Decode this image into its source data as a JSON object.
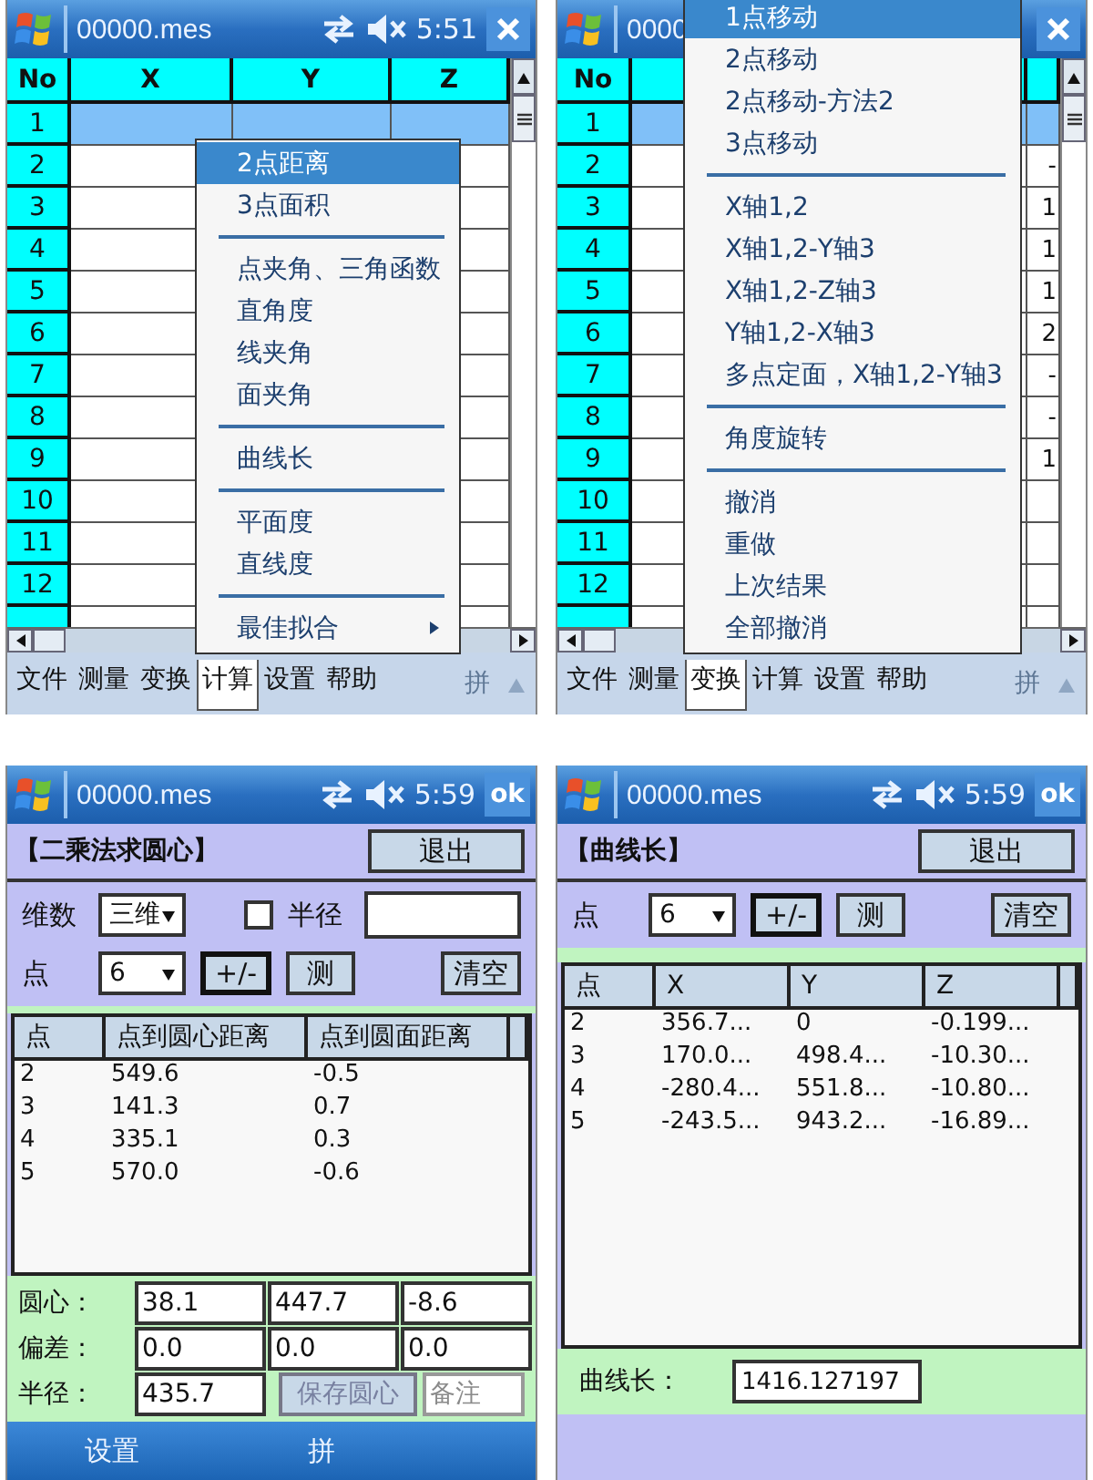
{
  "screens": [
    {
      "kind": "table_menu",
      "title": "00000.mes",
      "time": "5:51",
      "action": {
        "kind": "close"
      },
      "columns": [
        {
          "kind": "number",
          "label": "No"
        },
        {
          "kind": "data",
          "label": "X"
        },
        {
          "kind": "data",
          "label": "Y"
        },
        {
          "kind": "data",
          "label": "Z"
        }
      ],
      "rows": [
        {
          "no": "1",
          "selected": true
        },
        {
          "no": "2",
          "selected": false
        },
        {
          "no": "3",
          "selected": false
        },
        {
          "no": "4",
          "selected": false
        },
        {
          "no": "5",
          "selected": false
        },
        {
          "no": "6",
          "selected": false
        },
        {
          "no": "7",
          "selected": false
        },
        {
          "no": "8",
          "selected": false
        },
        {
          "no": "9",
          "selected": false
        },
        {
          "no": "10",
          "selected": false
        },
        {
          "no": "11",
          "selected": false
        },
        {
          "no": "12",
          "selected": false
        }
      ],
      "menubar": [
        {
          "label": "文件",
          "selected": false
        },
        {
          "label": "测量",
          "selected": false
        },
        {
          "label": "变换",
          "selected": false
        },
        {
          "label": "计算",
          "selected": true
        },
        {
          "label": "设置",
          "selected": false
        },
        {
          "label": "帮助",
          "selected": false
        }
      ],
      "input_mode": "拼",
      "menu": [
        {
          "kind": "item",
          "label": "2点距离",
          "selected": true
        },
        {
          "kind": "item",
          "label": "3点面积",
          "selected": false
        },
        {
          "kind": "separator"
        },
        {
          "kind": "item",
          "label": "点夹角、三角函数",
          "selected": false
        },
        {
          "kind": "item",
          "label": "直角度",
          "selected": false
        },
        {
          "kind": "item",
          "label": "线夹角",
          "selected": false
        },
        {
          "kind": "item",
          "label": "面夹角",
          "selected": false
        },
        {
          "kind": "separator"
        },
        {
          "kind": "item",
          "label": "曲线长",
          "selected": false
        },
        {
          "kind": "separator"
        },
        {
          "kind": "item",
          "label": "平面度",
          "selected": false
        },
        {
          "kind": "item",
          "label": "直线度",
          "selected": false
        },
        {
          "kind": "separator"
        },
        {
          "kind": "submenu",
          "label": "最佳拟合",
          "selected": false
        }
      ]
    },
    {
      "kind": "table_menu",
      "title": "0000",
      "action": {
        "kind": "close"
      },
      "columns": [
        {
          "kind": "number",
          "label": "No"
        },
        {
          "kind": "data"
        },
        {
          "kind": "data"
        }
      ],
      "rows": [
        {
          "no": "1",
          "selected": true
        },
        {
          "no": "2",
          "selected": false,
          "column_3": "-"
        },
        {
          "no": "3",
          "selected": false,
          "column_3": "1"
        },
        {
          "no": "4",
          "selected": false,
          "column_3": "1"
        },
        {
          "no": "5",
          "selected": false,
          "column_3": "1"
        },
        {
          "no": "6",
          "selected": false,
          "column_3": "2"
        },
        {
          "no": "7",
          "selected": false,
          "column_3": "-"
        },
        {
          "no": "8",
          "selected": false,
          "column_3": "-"
        },
        {
          "no": "9",
          "selected": false,
          "column_3": "1"
        },
        {
          "no": "10",
          "selected": false
        },
        {
          "no": "11",
          "selected": false
        },
        {
          "no": "12",
          "selected": false
        }
      ],
      "menubar": [
        {
          "label": "文件",
          "selected": false
        },
        {
          "label": "测量",
          "selected": false
        },
        {
          "label": "变换",
          "selected": true
        },
        {
          "label": "计算",
          "selected": false
        },
        {
          "label": "设置",
          "selected": false
        },
        {
          "label": "帮助",
          "selected": false
        }
      ],
      "input_mode": "拼",
      "menu": [
        {
          "kind": "item",
          "label": "1点移动",
          "selected": true
        },
        {
          "kind": "item",
          "label": "2点移动",
          "selected": false
        },
        {
          "kind": "item",
          "label": "2点移动-方法2",
          "selected": false
        },
        {
          "kind": "item",
          "label": "3点移动",
          "selected": false
        },
        {
          "kind": "separator"
        },
        {
          "kind": "item",
          "label": "X轴1,2",
          "selected": false
        },
        {
          "kind": "item",
          "label": "X轴1,2-Y轴3",
          "selected": false
        },
        {
          "kind": "item",
          "label": "X轴1,2-Z轴3",
          "selected": false
        },
        {
          "kind": "item",
          "label": "Y轴1,2-X轴3",
          "selected": false
        },
        {
          "kind": "item",
          "label": "多点定面，X轴1,2-Y轴3",
          "selected": false
        },
        {
          "kind": "separator"
        },
        {
          "kind": "item",
          "label": "角度旋转",
          "selected": false
        },
        {
          "kind": "separator"
        },
        {
          "kind": "item",
          "label": "撤消",
          "selected": false
        },
        {
          "kind": "item",
          "label": "重做",
          "selected": false
        },
        {
          "kind": "item",
          "label": "上次结果",
          "selected": false
        },
        {
          "kind": "item",
          "label": "全部撤消",
          "selected": false
        }
      ]
    },
    {
      "kind": "form",
      "title": "00000.mes",
      "time": "5:59",
      "action": {
        "kind": "ok",
        "label": "ok"
      },
      "heading": "【二乘法求圆心】",
      "exit": "退出",
      "dimension": {
        "label": "维数",
        "value": "三维"
      },
      "radius_option": {
        "label": "半径",
        "checked": false
      },
      "point": {
        "label": "点",
        "value": "6"
      },
      "buttons": [
        {
          "label": "+/-",
          "default": true
        },
        {
          "label": "测",
          "default": false
        },
        {
          "label": "清空",
          "default": false
        }
      ],
      "list_columns": [
        "点",
        "点到圆心距离",
        "点到圆面距离"
      ],
      "list_rows": [
        [
          "2",
          "549.6",
          "-0.5"
        ],
        [
          "3",
          "141.3",
          "0.7"
        ],
        [
          "4",
          "335.1",
          "0.3"
        ],
        [
          "5",
          "570.0",
          "-0.6"
        ]
      ],
      "results": [
        {
          "label": "圆心：",
          "values": [
            "38.1",
            "447.7",
            "-8.6"
          ]
        },
        {
          "label": "偏差：",
          "values": [
            "0.0",
            "0.0",
            "0.0"
          ]
        }
      ],
      "radius": {
        "label": "半径：",
        "value": "435.7"
      },
      "save_button": {
        "label": "保存圆心",
        "disabled": true
      },
      "note_field": {
        "value": "备注",
        "disabled": true
      },
      "softkeys": [
        "设置",
        "拼"
      ]
    },
    {
      "kind": "form",
      "title": "00000.mes",
      "time": "5:59",
      "action": {
        "kind": "ok",
        "label": "ok"
      },
      "heading": "【曲线长】",
      "exit": "退出",
      "point": {
        "label": "点",
        "value": "6"
      },
      "buttons": [
        {
          "label": "+/-",
          "default": true
        },
        {
          "label": "测",
          "default": false
        },
        {
          "label": "清空",
          "default": false
        }
      ],
      "list_columns": [
        "点",
        "X",
        "Y",
        "Z"
      ],
      "list_rows": [
        [
          "2",
          "356.7...",
          "0",
          "-0.199..."
        ],
        [
          "3",
          "170.0...",
          "498.4...",
          "-10.30..."
        ],
        [
          "4",
          "-280.4...",
          "551.8...",
          "-10.80..."
        ],
        [
          "5",
          "-243.5...",
          "943.2...",
          "-16.89..."
        ]
      ],
      "curve_length": {
        "label": "曲线长：",
        "value": "1416.127197"
      }
    }
  ]
}
